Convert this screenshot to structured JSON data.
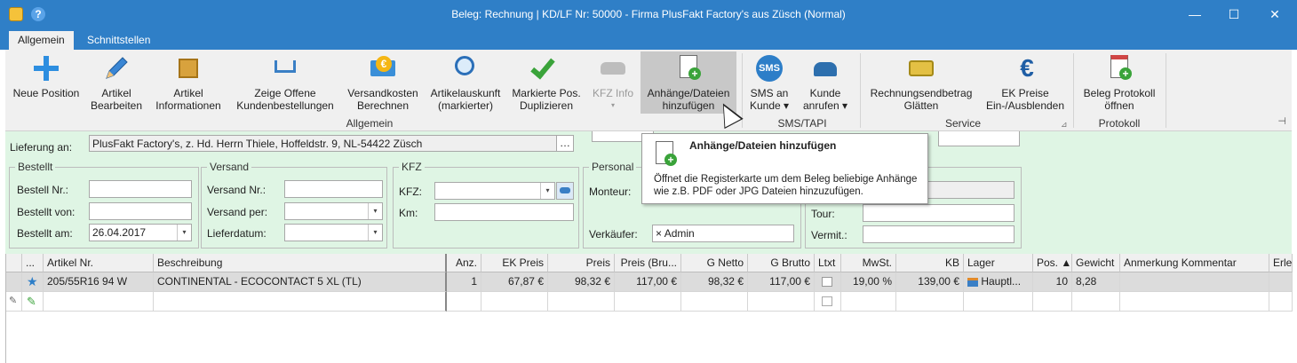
{
  "window": {
    "title": "Beleg: Rechnung |  KD/LF Nr: 50000 - Firma PlusFakt Factory's  aus Züsch (Normal)",
    "help_glyph": "?",
    "minimize": "—",
    "maximize": "☐",
    "close": "✕"
  },
  "tabs": [
    {
      "label": "Allgemein",
      "active": true
    },
    {
      "label": "Schnittstellen",
      "active": false
    }
  ],
  "ribbon": {
    "buttons": [
      {
        "line1": "Neue Position",
        "line2": ""
      },
      {
        "line1": "Artikel",
        "line2": "Bearbeiten"
      },
      {
        "line1": "Artikel",
        "line2": "Informationen"
      },
      {
        "line1": "Zeige Offene",
        "line2": "Kundenbestellungen"
      },
      {
        "line1": "Versandkosten",
        "line2": "Berechnen"
      },
      {
        "line1": "Artikelauskunft",
        "line2": "(markierter)"
      },
      {
        "line1": "Markierte Pos.",
        "line2": "Duplizieren"
      },
      {
        "line1": "KFZ Info",
        "line2": "▾"
      },
      {
        "line1": "Anhänge/Dateien",
        "line2": "hinzufügen"
      },
      {
        "line1": "SMS an",
        "line2": "Kunde ▾"
      },
      {
        "line1": "Kunde",
        "line2": "anrufen ▾"
      },
      {
        "line1": "Rechnungsendbetrag",
        "line2": "Glätten"
      },
      {
        "line1": "EK Preise",
        "line2": "Ein-/Ausblenden"
      },
      {
        "line1": "Beleg Protokoll",
        "line2": "öffnen"
      }
    ],
    "groups": [
      "Allgemein",
      "SMS/TAPI",
      "Service",
      "Protokoll"
    ],
    "sms_icon_text": "SMS",
    "euro_symbol": "€",
    "launcher": "⊿",
    "pin": "⊣"
  },
  "form": {
    "lieferung_label": "Lieferung an:",
    "lieferung_value": "PlusFakt Factory's, z. Hd. Herrn Thiele, Hoffeldstr. 9, NL-54422 Züsch",
    "ellipsis": "…",
    "bestellt": {
      "legend": "Bestellt",
      "nr_label": "Bestell Nr.:",
      "von_label": "Bestellt von:",
      "am_label": "Bestellt am:",
      "am_value": "26.04.2017"
    },
    "versand": {
      "legend": "Versand",
      "nr_label": "Versand Nr.:",
      "per_label": "Versand per:",
      "lieferdatum_label": "Lieferdatum:"
    },
    "kfz": {
      "legend": "KFZ",
      "kfz_label": "KFZ:",
      "km_label": "Km:"
    },
    "personal": {
      "legend": "Personal",
      "monteur_label": "Monteur:",
      "verkaeufer_label": "Verkäufer:",
      "verkaeufer_value": "Admin",
      "remove_glyph": "×"
    },
    "right": {
      "tour_label": "Tour:",
      "vermit_label": "Vermit.:"
    },
    "dropdown_glyph": "▾"
  },
  "grid": {
    "columns": [
      "...",
      "Artikel Nr.",
      "Beschreibung",
      "Anz.",
      "EK Preis",
      "Preis",
      "Preis (Bru...",
      "G Netto",
      "G Brutto",
      "Ltxt",
      "MwSt.",
      "KB",
      "Lager",
      "Pos. ▲",
      "Gewicht",
      "Anmerkung Kommentar",
      "Erle"
    ],
    "rows": [
      {
        "artikel_nr": "205/55R16 94 W",
        "beschreibung": "CONTINENTAL - ECOCONTACT 5 XL (TL)",
        "anz": "1",
        "ek_preis": "67,87 €",
        "preis": "98,32 €",
        "preis_brutto": "117,00 €",
        "g_netto": "98,32 €",
        "g_brutto": "117,00 €",
        "mwst": "19,00 %",
        "kb": "139,00 €",
        "lager": "Hauptl...",
        "pos": "10",
        "gewicht": "8,28"
      }
    ],
    "star_glyph": "★",
    "edit_glyph": "✎"
  },
  "tooltip": {
    "title": "Anhänge/Dateien hinzufügen",
    "body": "Öffnet die Registerkarte um dem Beleg beliebige Anhänge wie z.B. PDF oder JPG Dateien hinzuzufügen."
  },
  "colors": {
    "titlebar": "#2f7fc7",
    "form_background": "#dff5e4",
    "selected_row": "#dcdcdc",
    "hover_button": "#c8c8c8"
  }
}
